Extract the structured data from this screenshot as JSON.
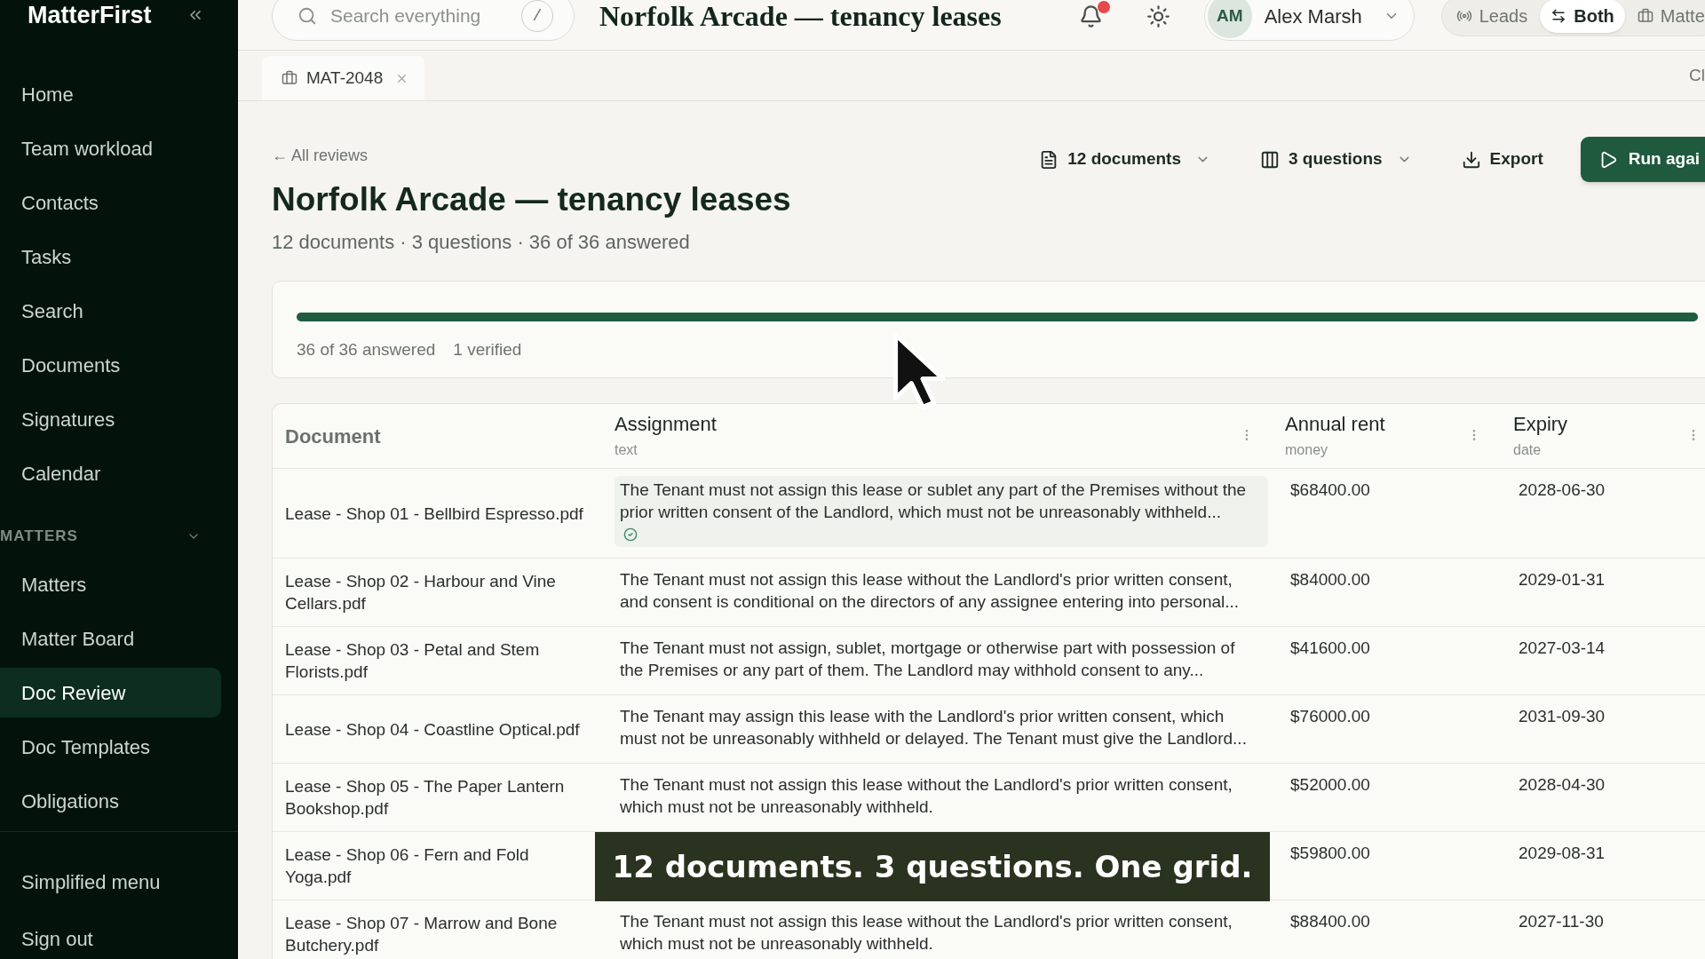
{
  "sidebar": {
    "brand": "MatterFirst",
    "nav": [
      {
        "label": "Home",
        "selected": false
      },
      {
        "label": "Team workload",
        "selected": false
      },
      {
        "label": "Contacts",
        "selected": false
      },
      {
        "label": "Tasks",
        "selected": false
      },
      {
        "label": "Search",
        "selected": false
      },
      {
        "label": "Documents",
        "selected": false
      },
      {
        "label": "Signatures",
        "selected": false
      },
      {
        "label": "Calendar",
        "selected": false
      }
    ],
    "section": {
      "title": "MATTERS",
      "expanded": true,
      "items": [
        {
          "label": "Matters",
          "selected": false
        },
        {
          "label": "Matter Board",
          "selected": false
        },
        {
          "label": "Doc Review",
          "selected": true
        },
        {
          "label": "Doc Templates",
          "selected": false
        },
        {
          "label": "Obligations",
          "selected": false
        }
      ]
    },
    "footer": [
      {
        "label": "Simplified menu"
      },
      {
        "label": "Sign out"
      }
    ]
  },
  "top_bar": {
    "search": {
      "placeholder": "Search everything",
      "shortcut": "/"
    },
    "title": "Norfolk Arcade — tenancy leases",
    "notifications": {
      "unread": true
    },
    "user": {
      "initials": "AM",
      "name": "Alex Marsh"
    },
    "view_toggle": [
      {
        "label": "Leads",
        "selected": false
      },
      {
        "label": "Both",
        "selected": true
      },
      {
        "label": "Matte",
        "selected": false
      }
    ]
  },
  "open_tabs": [
    {
      "label": "MAT-2048",
      "selected": true
    }
  ],
  "tab_bar_action": "Cl",
  "review": {
    "back_link": "← All reviews",
    "title": "Norfolk Arcade — tenancy leases",
    "summary": "12 documents · 3 questions · 36 of 36 answered",
    "toolbar": [
      {
        "kind": "dropdown",
        "label": "12 documents"
      },
      {
        "kind": "dropdown",
        "label": "3 questions"
      },
      {
        "kind": "action",
        "label": "Export"
      },
      {
        "kind": "primary",
        "label": "Run agai"
      }
    ],
    "progress": {
      "level": 1,
      "answered": "36 of 36 answered",
      "verified": "1 verified"
    }
  },
  "table": {
    "columns": [
      {
        "kind": "document",
        "title": "Document"
      },
      {
        "kind": "question",
        "title": "Assignment",
        "data_type": "text"
      },
      {
        "kind": "question",
        "title": "Annual rent",
        "data_type": "money"
      },
      {
        "kind": "question",
        "title": "Expiry",
        "data_type": "date"
      }
    ],
    "rows": [
      {
        "document": "Lease - Shop 01 - Bellbird Espresso.pdf",
        "assignment": "The Tenant must not assign this lease or sublet any part of the Premises without the prior written consent of the Landlord, which must not be unreasonably withheld...",
        "verified": true,
        "annual_rent": "$68400.00",
        "expiry": "2028-06-30"
      },
      {
        "document": "Lease - Shop 02 - Harbour and Vine Cellars.pdf",
        "assignment": "The Tenant must not assign this lease without the Landlord's prior written consent, and consent is conditional on the directors of any assignee entering into personal...",
        "verified": false,
        "annual_rent": "$84000.00",
        "expiry": "2029-01-31"
      },
      {
        "document": "Lease - Shop 03 - Petal and Stem Florists.pdf",
        "assignment": "The Tenant must not assign, sublet, mortgage or otherwise part with possession of the Premises or any part of them. The Landlord may withhold consent to any...",
        "verified": false,
        "annual_rent": "$41600.00",
        "expiry": "2027-03-14"
      },
      {
        "document": "Lease - Shop 04 - Coastline Optical.pdf",
        "assignment": "The Tenant may assign this lease with the Landlord's prior written consent, which must not be unreasonably withheld or delayed. The Tenant must give the Landlord...",
        "verified": false,
        "annual_rent": "$76000.00",
        "expiry": "2031-09-30"
      },
      {
        "document": "Lease - Shop 05 - The Paper Lantern Bookshop.pdf",
        "assignment": "The Tenant must not assign this lease without the Landlord's prior written consent, which must not be unreasonably withheld.",
        "verified": false,
        "annual_rent": "$52000.00",
        "expiry": "2028-04-30"
      },
      {
        "document": "Lease - Shop 06 - Fern and Fold Yoga.pdf",
        "annual_rent": "$59800.00",
        "expiry": "2029-08-31"
      },
      {
        "document": "Lease - Shop 07 - Marrow and Bone Butchery.pdf",
        "assignment": "The Tenant must not assign this lease without the Landlord's prior written consent, which must not be unreasonably withheld.",
        "verified": false,
        "annual_rent": "$88400.00",
        "expiry": "2027-11-30"
      }
    ]
  },
  "caption": "12 documents. 3 questions. One grid."
}
